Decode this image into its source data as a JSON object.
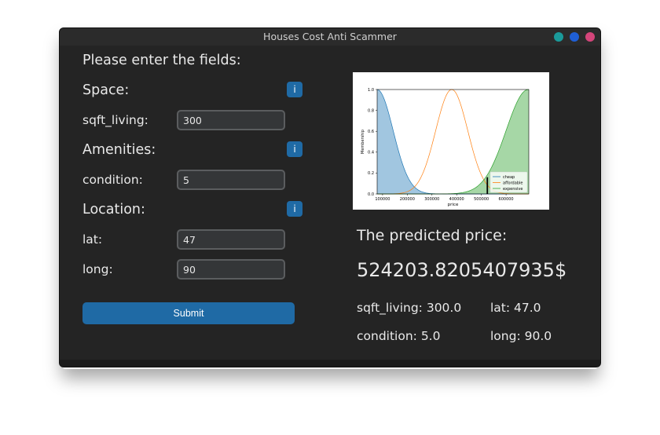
{
  "window": {
    "title": "Houses Cost Anti Scammer",
    "buttons": [
      {
        "name": "minimize",
        "color": "#1a9a9a"
      },
      {
        "name": "maximize",
        "color": "#1f5fd6"
      },
      {
        "name": "close",
        "color": "#d4457a"
      }
    ]
  },
  "form": {
    "heading": "Please enter the fields:",
    "info_glyph": "i",
    "sections": {
      "space": "Space:",
      "amenities": "Amenities:",
      "location": "Location:"
    },
    "fields": {
      "sqft_living": {
        "label": "sqft_living:",
        "value": "300"
      },
      "condition": {
        "label": "condition:",
        "value": "5"
      },
      "lat": {
        "label": "lat:",
        "value": "47"
      },
      "long": {
        "label": "long:",
        "value": "90"
      }
    },
    "submit_label": "Submit",
    "accent_color": "#1f6aa5"
  },
  "result": {
    "heading": "The predicted price:",
    "price": "524203.8205407935$",
    "summary": {
      "sqft_living": "sqft_living: 300.0",
      "lat": "lat: 47.0",
      "condition": "condition: 5.0",
      "long": "long: 90.0"
    }
  },
  "chart_data": {
    "type": "area",
    "xlabel": "price",
    "ylabel": "Membership",
    "xlim": [
      78000,
      692000
    ],
    "ylim": [
      0,
      1.0
    ],
    "xticks": [
      100000,
      200000,
      300000,
      400000,
      500000,
      600000
    ],
    "xtick_labels": [
      "100000",
      "200000",
      "300000",
      "400000",
      "500000",
      "600000"
    ],
    "yticks": [
      0.0,
      0.2,
      0.4,
      0.6,
      0.8,
      1.0
    ],
    "ytick_labels": [
      "0.0",
      "0.2",
      "0.4",
      "0.6",
      "0.8",
      "1.0"
    ],
    "legend_position": "bottom-right",
    "series": [
      {
        "name": "cheap",
        "color": "#1f77b4",
        "filled": true,
        "center": 78000,
        "sigma": 65000,
        "side": "right"
      },
      {
        "name": "affordable",
        "color": "#ff7f0e",
        "filled": false,
        "center": 380000,
        "sigma": 65000,
        "side": "both"
      },
      {
        "name": "expensive",
        "color": "#2ca02c",
        "filled": true,
        "center": 690000,
        "sigma": 90000,
        "side": "left"
      }
    ],
    "marker": {
      "x": 524203.82,
      "y": 0.16
    }
  }
}
